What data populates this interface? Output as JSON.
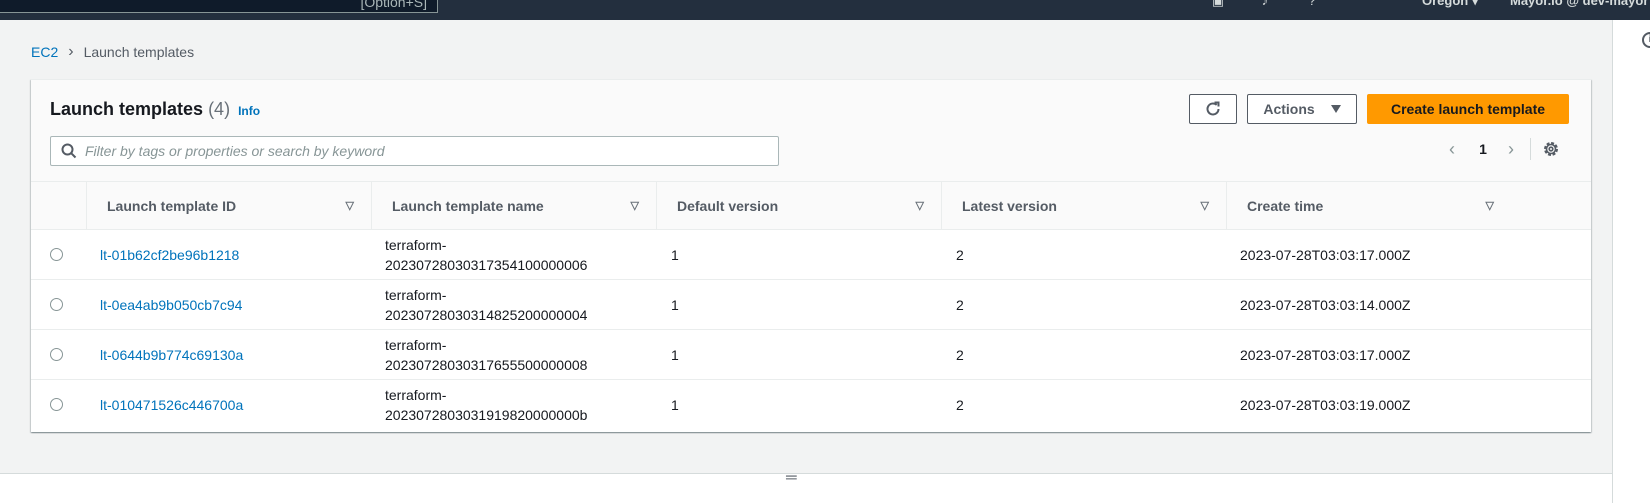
{
  "topbar": {
    "search_shortcut": "[Option+S]",
    "region": "Oregon ▾",
    "account": "Mayor.io @ dev-mayor ▾",
    "icons": [
      "cloudshell-icon",
      "notifications-icon",
      "help-icon"
    ]
  },
  "breadcrumb": {
    "root": "EC2",
    "separator": "›",
    "current": "Launch templates"
  },
  "panel": {
    "title": "Launch templates",
    "count": "(4)",
    "info": "Info"
  },
  "toolbar": {
    "actions_label": "Actions",
    "create_label": "Create launch template"
  },
  "search": {
    "placeholder": "Filter by tags or properties or search by keyword"
  },
  "pagination": {
    "current_page": "1"
  },
  "table": {
    "columns": [
      "Launch template ID",
      "Launch template name",
      "Default version",
      "Latest version",
      "Create time"
    ],
    "rows": [
      {
        "id": "lt-01b62cf2be96b1218",
        "name_line1": "terraform-",
        "name_line2": "20230728030317354100000006",
        "default_version": "1",
        "latest_version": "2",
        "create_time": "2023-07-28T03:03:17.000Z"
      },
      {
        "id": "lt-0ea4ab9b050cb7c94",
        "name_line1": "terraform-",
        "name_line2": "20230728030314825200000004",
        "default_version": "1",
        "latest_version": "2",
        "create_time": "2023-07-28T03:03:14.000Z"
      },
      {
        "id": "lt-0644b9b774c69130a",
        "name_line1": "terraform-",
        "name_line2": "20230728030317655500000008",
        "default_version": "1",
        "latest_version": "2",
        "create_time": "2023-07-28T03:03:17.000Z"
      },
      {
        "id": "lt-010471526c446700a",
        "name_line1": "terraform-",
        "name_line2": "2023072803031919820000000b",
        "default_version": "1",
        "latest_version": "2",
        "create_time": "2023-07-28T03:03:19.000Z"
      }
    ]
  },
  "colors": {
    "link": "#0073bb",
    "primary_button": "#ff9900",
    "topbar": "#232f3e"
  }
}
